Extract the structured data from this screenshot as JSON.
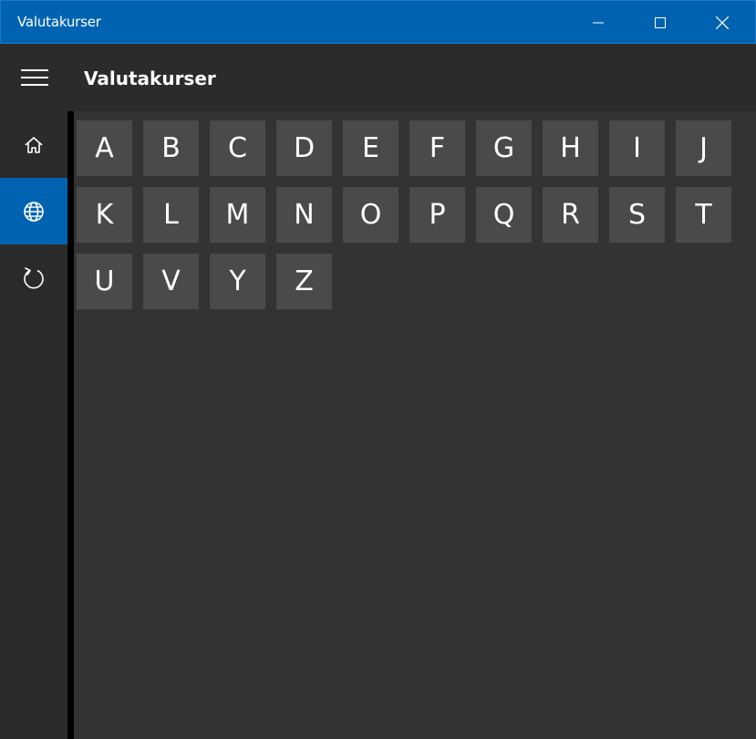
{
  "window": {
    "title": "Valutakurser"
  },
  "header": {
    "app_title": "Valutakurser"
  },
  "nav": {
    "items": [
      {
        "icon": "home-icon",
        "selected": false
      },
      {
        "icon": "globe-icon",
        "selected": true
      },
      {
        "icon": "refresh-icon",
        "selected": false
      }
    ]
  },
  "letters": [
    "A",
    "B",
    "C",
    "D",
    "E",
    "F",
    "G",
    "H",
    "I",
    "J",
    "K",
    "L",
    "M",
    "N",
    "O",
    "P",
    "Q",
    "R",
    "S",
    "T",
    "U",
    "V",
    "Y",
    "Z"
  ],
  "colors": {
    "accent": "#0063b1",
    "background": "#2b2b2b",
    "content": "#333333",
    "tile": "#4a4a4a"
  }
}
